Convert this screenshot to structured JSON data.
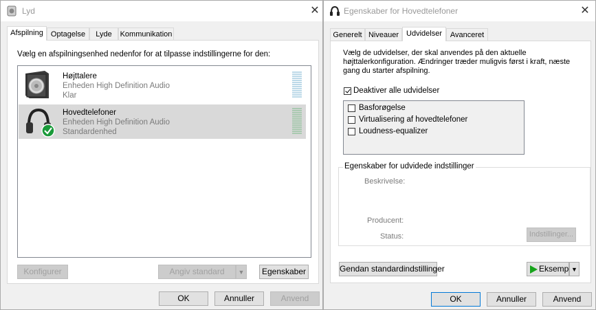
{
  "colors": {
    "accent": "#0078d7",
    "selection": "#d9d9d9",
    "check_green": "#1a9a3a",
    "play_green": "#16a31b"
  },
  "left_dialog": {
    "title": "Lyd",
    "close_icon": "close-icon",
    "tabs": [
      "Afspilning",
      "Optagelse",
      "Lyde",
      "Kommunikation"
    ],
    "instruction": "Vælg en afspilningsenhed nedenfor for at tilpasse indstillingerne for den:",
    "devices": [
      {
        "name": "Højttalere",
        "desc": "Enheden High Definition Audio",
        "status": "Klar",
        "icon": "speaker-icon",
        "selected": false
      },
      {
        "name": "Hovedtelefoner",
        "desc": "Enheden High Definition Audio",
        "status": "Standardenhed",
        "icon": "headphones-icon",
        "selected": true
      }
    ],
    "buttons": {
      "configure": "Konfigurer",
      "set_default": "Angiv standard",
      "properties": "Egenskaber",
      "ok": "OK",
      "cancel": "Annuller",
      "apply": "Anvend"
    }
  },
  "right_dialog": {
    "title": "Egenskaber for Hovedtelefoner",
    "tabs": [
      "Generelt",
      "Niveauer",
      "Udvidelser",
      "Avanceret"
    ],
    "description": [
      "Vælg de udvidelser, der skal anvendes på den aktuelle",
      "højttalerkonfiguration. Ændringer træder muligvis først i kraft, næste",
      "gang du starter afspilning."
    ],
    "disable_all": {
      "label": "Deaktiver alle udvidelser",
      "checked": true
    },
    "enhancements": [
      {
        "label": "Basforøgelse",
        "checked": false
      },
      {
        "label": "Virtualisering af hovedtelefoner",
        "checked": false
      },
      {
        "label": "Loudness-equalizer",
        "checked": false
      }
    ],
    "group_title": "Egenskaber for udvidede indstillinger",
    "props": {
      "description": "Beskrivelse:",
      "producer": "Producent:",
      "status": "Status:",
      "settings_button": "Indstillinger..."
    },
    "buttons": {
      "restore": "Gendan standardindstillinger",
      "preview": "Eksempel",
      "ok": "OK",
      "cancel": "Annuller",
      "apply": "Anvend"
    }
  }
}
